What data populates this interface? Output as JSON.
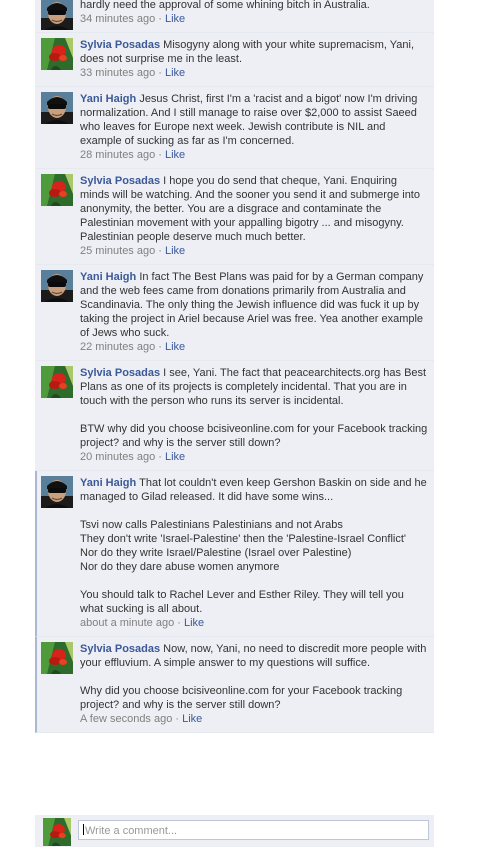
{
  "comments": [
    {
      "author": "",
      "text": "hardly need the approval of some whining bitch in Australia.",
      "time": "34 minutes ago",
      "like": "Like",
      "avatar": "yani"
    },
    {
      "author": "Sylvia Posadas",
      "text": "Misogyny along with your white supremacism, Yani, does not surprise me in the least.",
      "time": "33 minutes ago",
      "like": "Like",
      "avatar": "sylvia"
    },
    {
      "author": "Yani Haigh",
      "text": "Jesus Christ, first I'm a 'racist and a bigot' now I'm driving normalization. And I still manage to raise over $2,000 to assist Saeed who leaves for Europe next week. Jewish contribute is NIL and example of sucking as far as I'm concerned.",
      "time": "28 minutes ago",
      "like": "Like",
      "avatar": "yani"
    },
    {
      "author": "Sylvia Posadas",
      "text": "I hope you do send that cheque, Yani. Enquiring minds will be watching. And the sooner you send it and submerge into anonymity, the better. You are a disgrace and contaminate the Palestinian movement with your appalling bigotry ... and misogyny. Palestinian people deserve much much better.",
      "time": "25 minutes ago",
      "like": "Like",
      "avatar": "sylvia"
    },
    {
      "author": "Yani Haigh",
      "text": "In fact The Best Plans was paid for by a German company and the web fees came from donations primarily from Australia and Scandinavia. The only thing the Jewish influence did was fuck it up by taking the project in Ariel because Ariel was free. Yea another example of Jews who suck.",
      "time": "22 minutes ago",
      "like": "Like",
      "avatar": "yani"
    },
    {
      "author": "Sylvia Posadas",
      "text": "I see, Yani. The fact that peacearchitects.org has Best Plans as one of its projects is completely incidental. That you are in touch with the person who runs its server is incidental.\n\nBTW why did you choose bcisiveonline.com for your Facebook tracking project? and why is the server still down?",
      "time": "20 minutes ago",
      "like": "Like",
      "avatar": "sylvia"
    },
    {
      "author": "Yani Haigh",
      "text": "That lot couldn't even keep Gershon Baskin on side and he managed to Gilad released. It did have some wins...\n\nTsvi now calls Palestinians Palestinians and not Arabs\nThey don't write 'Israel-Palestine' then the 'Palestine-Israel Conflict'\nNor do they write Israel/Palestine (Israel over Palestine)\nNor do they dare abuse women anymore\n\nYou should talk to Rachel Lever and Esther Riley. They will tell you what sucking is all about.",
      "time": "about a minute ago",
      "like": "Like",
      "avatar": "yani",
      "unread": true
    },
    {
      "author": "Sylvia Posadas",
      "text": "Now, now, Yani, no need to discredit more people with your effluvium. A simple answer to my questions will suffice.\n\nWhy did you choose bcisiveonline.com for your Facebook tracking project? and why is the server still down?",
      "time": "A few seconds ago",
      "like": "Like",
      "avatar": "sylvia",
      "unread": true
    }
  ],
  "composer": {
    "placeholder": "Write a comment..."
  },
  "separator": " · "
}
